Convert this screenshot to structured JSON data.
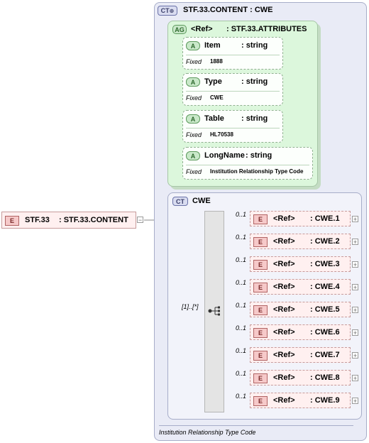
{
  "root_element": {
    "badge": "E",
    "name": "STF.33",
    "type": ": STF.33.CONTENT"
  },
  "complex_type": {
    "badge": "CT",
    "title": "STF.33.CONTENT : CWE",
    "footer_doc": "Institution Relationship Type Code"
  },
  "attribute_group": {
    "badge": "AG",
    "ref": "<Ref>",
    "type": ": STF.33.ATTRIBUTES",
    "attributes": [
      {
        "badge": "A",
        "name": "Item",
        "type": ": string",
        "fixed_label": "Fixed",
        "fixed_value": "1888"
      },
      {
        "badge": "A",
        "name": "Type",
        "type": ": string",
        "fixed_label": "Fixed",
        "fixed_value": "CWE"
      },
      {
        "badge": "A",
        "name": "Table",
        "type": ": string",
        "fixed_label": "Fixed",
        "fixed_value": "HL70538"
      },
      {
        "badge": "A",
        "name": "LongName",
        "type": ": string",
        "fixed_label": "Fixed",
        "fixed_value": "Institution Relationship Type Code"
      }
    ]
  },
  "cwe_type": {
    "badge": "CT",
    "title": "CWE",
    "sequence_cardinality": "[1]..[*]",
    "elements": [
      {
        "occurs": "0..1",
        "badge": "E",
        "ref": "<Ref>",
        "type": ": CWE.1"
      },
      {
        "occurs": "0..1",
        "badge": "E",
        "ref": "<Ref>",
        "type": ": CWE.2"
      },
      {
        "occurs": "0..1",
        "badge": "E",
        "ref": "<Ref>",
        "type": ": CWE.3"
      },
      {
        "occurs": "0..1",
        "badge": "E",
        "ref": "<Ref>",
        "type": ": CWE.4"
      },
      {
        "occurs": "0..1",
        "badge": "E",
        "ref": "<Ref>",
        "type": ": CWE.5"
      },
      {
        "occurs": "0..1",
        "badge": "E",
        "ref": "<Ref>",
        "type": ": CWE.6"
      },
      {
        "occurs": "0..1",
        "badge": "E",
        "ref": "<Ref>",
        "type": ": CWE.7"
      },
      {
        "occurs": "0..1",
        "badge": "E",
        "ref": "<Ref>",
        "type": ": CWE.8"
      },
      {
        "occurs": "0..1",
        "badge": "E",
        "ref": "<Ref>",
        "type": ": CWE.9"
      }
    ]
  },
  "colors": {
    "complex_type_bg": "#e9ebf6",
    "attribute_group_bg": "#dcf7dc",
    "element_bg": "#fff0f0",
    "connector": "#8a8a8a"
  }
}
